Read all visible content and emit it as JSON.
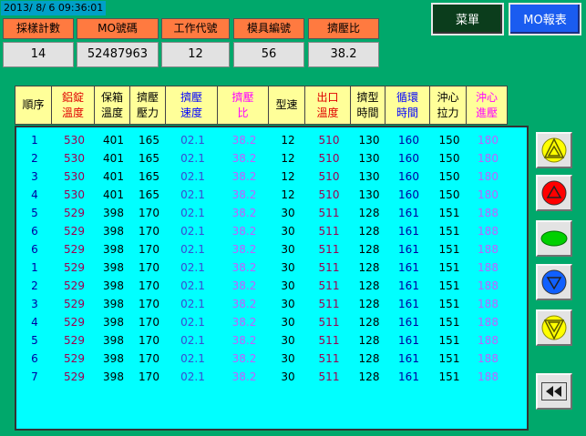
{
  "clock": "2013/ 8/ 6 09:36:01",
  "header": [
    {
      "label": "採樣計數",
      "value": "14"
    },
    {
      "label": "MO號碼",
      "value": "52487963"
    },
    {
      "label": "工作代號",
      "value": "12"
    },
    {
      "label": "模具編號",
      "value": "56"
    },
    {
      "label": "擠壓比",
      "value": "38.2"
    }
  ],
  "buttons": {
    "menu": "菜單",
    "report": "MO報表"
  },
  "columns": [
    {
      "l1": "順序",
      "l2": "",
      "color": "#000000"
    },
    {
      "l1": "鋁錠",
      "l2": "溫度",
      "color": "#e00000"
    },
    {
      "l1": "保箱",
      "l2": "溫度",
      "color": "#000000"
    },
    {
      "l1": "擠壓",
      "l2": "壓力",
      "color": "#000000"
    },
    {
      "l1": "擠壓",
      "l2": "速度",
      "color": "#0000ff"
    },
    {
      "l1": "擠壓",
      "l2": "比",
      "color": "#ff00ff"
    },
    {
      "l1": "型速",
      "l2": "",
      "color": "#000000"
    },
    {
      "l1": "出口",
      "l2": "溫度",
      "color": "#e00000"
    },
    {
      "l1": "擠型",
      "l2": "時間",
      "color": "#000000"
    },
    {
      "l1": "循環",
      "l2": "時間",
      "color": "#0000ff"
    },
    {
      "l1": "沖心",
      "l2": "拉力",
      "color": "#000000"
    },
    {
      "l1": "沖心",
      "l2": "進壓",
      "color": "#ff00ff"
    }
  ],
  "cellColors": [
    "#0000a0",
    "#a00050",
    "#000000",
    "#000000",
    "#3a4ad0",
    "#c060ff",
    "#000000",
    "#a00050",
    "#000000",
    "#0000a0",
    "#000000",
    "#c060ff"
  ],
  "rows": [
    [
      "1",
      "530",
      "401",
      "165",
      "02.1",
      "38.2",
      "12",
      "510",
      "130",
      "160",
      "150",
      "180"
    ],
    [
      "2",
      "530",
      "401",
      "165",
      "02.1",
      "38.2",
      "12",
      "510",
      "130",
      "160",
      "150",
      "180"
    ],
    [
      "3",
      "530",
      "401",
      "165",
      "02.1",
      "38.2",
      "12",
      "510",
      "130",
      "160",
      "150",
      "180"
    ],
    [
      "4",
      "530",
      "401",
      "165",
      "02.1",
      "38.2",
      "12",
      "510",
      "130",
      "160",
      "150",
      "180"
    ],
    [
      "5",
      "529",
      "398",
      "170",
      "02.1",
      "38.2",
      "30",
      "511",
      "128",
      "161",
      "151",
      "188"
    ],
    [
      "6",
      "529",
      "398",
      "170",
      "02.1",
      "38.2",
      "30",
      "511",
      "128",
      "161",
      "151",
      "188"
    ],
    [
      "6",
      "529",
      "398",
      "170",
      "02.1",
      "38.2",
      "30",
      "511",
      "128",
      "161",
      "151",
      "188"
    ],
    [
      "1",
      "529",
      "398",
      "170",
      "02.1",
      "38.2",
      "30",
      "511",
      "128",
      "161",
      "151",
      "188"
    ],
    [
      "2",
      "529",
      "398",
      "170",
      "02.1",
      "38.2",
      "30",
      "511",
      "128",
      "161",
      "151",
      "188"
    ],
    [
      "3",
      "529",
      "398",
      "170",
      "02.1",
      "38.2",
      "30",
      "511",
      "128",
      "161",
      "151",
      "188"
    ],
    [
      "4",
      "529",
      "398",
      "170",
      "02.1",
      "38.2",
      "30",
      "511",
      "128",
      "161",
      "151",
      "188"
    ],
    [
      "5",
      "529",
      "398",
      "170",
      "02.1",
      "38.2",
      "30",
      "511",
      "128",
      "161",
      "151",
      "188"
    ],
    [
      "6",
      "529",
      "398",
      "170",
      "02.1",
      "38.2",
      "30",
      "511",
      "128",
      "161",
      "151",
      "188"
    ],
    [
      "7",
      "529",
      "398",
      "170",
      "02.1",
      "38.2",
      "30",
      "511",
      "128",
      "161",
      "151",
      "188"
    ]
  ],
  "sideButtons": [
    {
      "name": "page-up-button",
      "icon": "double-up-triangle-icon",
      "color": "#ffff00"
    },
    {
      "name": "scroll-up-button",
      "icon": "up-triangle-icon",
      "color": "#ff0000"
    },
    {
      "name": "center-button",
      "icon": "green-oval-icon",
      "color": "#00d000"
    },
    {
      "name": "scroll-down-button",
      "icon": "down-triangle-icon",
      "color": "#1060ff"
    },
    {
      "name": "page-down-button",
      "icon": "double-down-triangle-icon",
      "color": "#ffff00"
    },
    {
      "name": "back-button",
      "icon": "rewind-icon",
      "color": "#1a1a1a"
    }
  ]
}
